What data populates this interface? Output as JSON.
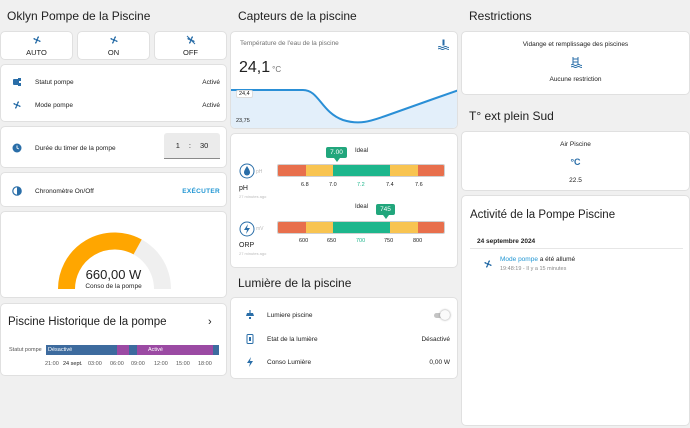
{
  "col1": {
    "title": "Oklyn Pompe de la Piscine",
    "modes": [
      {
        "label": "AUTO",
        "icon": "fan-auto-icon"
      },
      {
        "label": "ON",
        "icon": "fan-icon"
      },
      {
        "label": "OFF",
        "icon": "fan-off-icon"
      }
    ],
    "status_rows": [
      {
        "label": "Statut pompe",
        "value": "Activé",
        "icon": "pump-icon"
      },
      {
        "label": "Mode pompe",
        "value": "Activé",
        "icon": "fan-icon"
      }
    ],
    "timer": {
      "label": "Durée du timer de la pompe",
      "hours": "1",
      "sep": ":",
      "minutes": "30",
      "icon": "clock-icon"
    },
    "chrono": {
      "label": "Chronomètre On/Off",
      "action": "EXÉCUTER",
      "icon": "timer-icon"
    },
    "gauge": {
      "value": "660,00 W",
      "label": "Conso de la pompe",
      "fraction": 0.66,
      "color": "#ffa600"
    },
    "history": {
      "title": "Piscine Historique de la pompe",
      "row_label": "Statut pompe",
      "seg1": "Désactivé",
      "seg2": "Activé",
      "ticks": [
        "21:00",
        "24 sept.",
        "03:00",
        "06:00",
        "09:00",
        "12:00",
        "15:00",
        "18:00"
      ]
    }
  },
  "col2": {
    "title": "Capteurs de la piscine",
    "temp": {
      "label": "Température de l'eau de la piscine",
      "value": "24,1",
      "unit": "°C",
      "ymax": "24,4",
      "ymin": "23,75",
      "icon": "pool-thermometer-icon"
    },
    "ph": {
      "label": "pH",
      "value": "7.00",
      "ideal": "Ideal",
      "sub": "27 minutes ago",
      "ticks": [
        "6.8",
        "7.0",
        "7.2",
        "7.4",
        "7.6"
      ]
    },
    "orp": {
      "label": "ORP",
      "value": "745",
      "ideal": "Ideal",
      "sub": "27 minutes ago",
      "ticks": [
        "600",
        "650",
        "700",
        "750",
        "800"
      ]
    },
    "light_title": "Lumière de la piscine",
    "light_rows": [
      {
        "label": "Lumiere piscine",
        "value": "",
        "icon": "ceiling-light-icon"
      },
      {
        "label": "Etat de la lumière",
        "value": "Désactivé",
        "icon": "light-switch-icon"
      },
      {
        "label": "Conso Lumière",
        "value": "0,00 W",
        "icon": "flash-icon"
      }
    ]
  },
  "col3": {
    "title": "Restrictions",
    "restr_label": "Vidange et remplissage des piscines",
    "restr_value": "Aucune restriction",
    "temp_title": "T° ext plein Sud",
    "air_label": "Air Piscine",
    "air_unit": "°C",
    "air_value": "22.5",
    "activity_title": "Activité de la Pompe Piscine",
    "activity_date": "24 septembre 2024",
    "activity_link": "Mode pompe",
    "activity_text": " a été allumé",
    "activity_time": "19:48:19 - Il y a 15 minutes"
  }
}
